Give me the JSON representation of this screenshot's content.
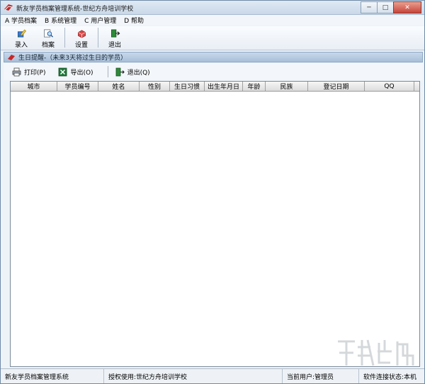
{
  "window": {
    "title": "新友学员档案管理系统-世纪方舟培训学校",
    "minimize": "─",
    "maximize": "□",
    "close": "✕"
  },
  "menu": [
    "A 学员档案",
    "B 系统管理",
    "C 用户管理",
    "D 帮助"
  ],
  "toolbar": {
    "entry": "录入",
    "archive": "档案",
    "settings": "设置",
    "exit": "退出"
  },
  "panel": {
    "title": "生日提醒-（未来3天将过生日的学员）"
  },
  "actions": {
    "print": "打印(P)",
    "export": "导出(O)",
    "exit": "退出(Q)"
  },
  "table": {
    "columns": [
      "城市",
      "学员编号",
      "姓名",
      "性别",
      "生日习惯",
      "出生年月日",
      "年龄",
      "民族",
      "登记日期",
      "QQ"
    ],
    "rows": []
  },
  "status": {
    "system": "新友学员档案管理系统",
    "license": "授权使用:世纪方舟培训学校",
    "user": "当前用户:管理员",
    "connection": "软件连接状态:本机"
  },
  "colors": {
    "accent": "#a8bfd8",
    "titlebar": "#c9d8e8",
    "close": "#c8443a"
  }
}
